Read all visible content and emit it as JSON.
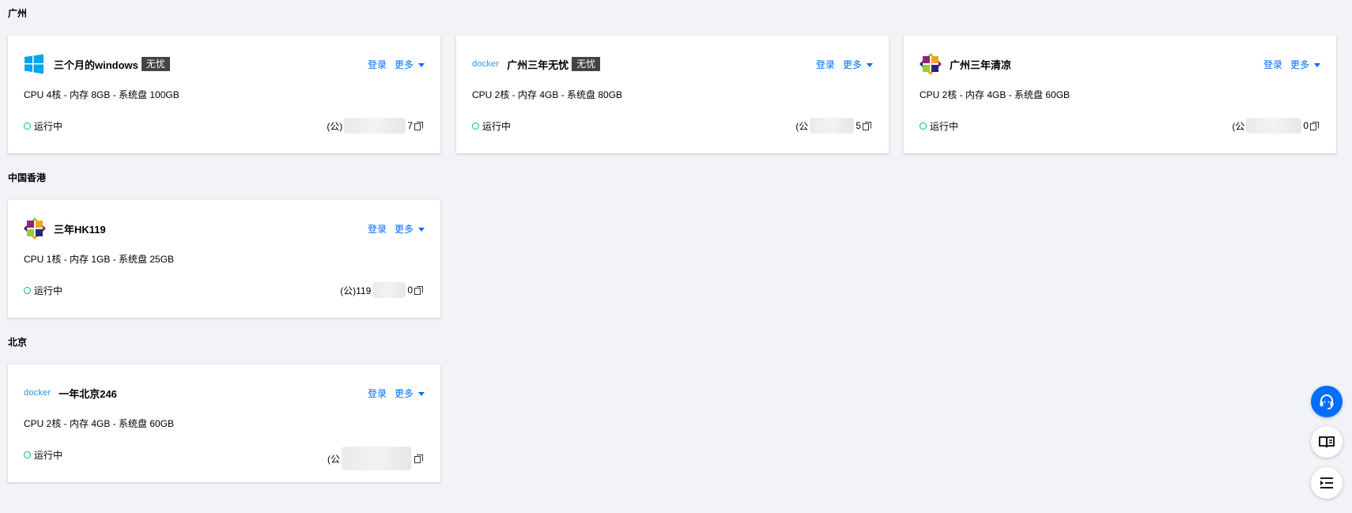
{
  "actions": {
    "login": "登录",
    "more": "更多"
  },
  "regions": [
    {
      "title": "广州",
      "instances": [
        {
          "logo": "windows-logo-icon",
          "name": "三个月的windows",
          "tag": "无忧",
          "spec": "CPU 4核 - 内存 8GB - 系统盘 100GB",
          "status": "运行中",
          "ip_prefix": "(公)",
          "ip_suffix": "7"
        },
        {
          "logo": "docker-logo",
          "logo_text": "docker",
          "name": "广州三年无忧",
          "tag": "无忧",
          "spec": "CPU 2核 - 内存 4GB - 系统盘 80GB",
          "status": "运行中",
          "ip_prefix": "(公",
          "ip_suffix": "5"
        },
        {
          "logo": "centos-logo-icon",
          "name": "广州三年清凉",
          "spec": "CPU 2核 - 内存 4GB - 系统盘 60GB",
          "status": "运行中",
          "ip_prefix": "(公",
          "ip_suffix": "0"
        }
      ]
    },
    {
      "title": "中国香港",
      "instances": [
        {
          "logo": "centos-logo-icon",
          "name": "三年HK119",
          "spec": "CPU 1核 - 内存 1GB - 系统盘 25GB",
          "status": "运行中",
          "ip_prefix": "(公)119",
          "ip_suffix": "0"
        }
      ]
    },
    {
      "title": "北京",
      "instances": [
        {
          "logo": "docker-logo",
          "logo_text": "docker",
          "name": "一年北京246",
          "spec": "CPU 2核 - 内存 4GB - 系统盘 60GB",
          "status": "运行中",
          "ip_prefix": "(公",
          "ip_suffix": ""
        }
      ]
    }
  ],
  "colors": {
    "accent": "#006eff",
    "running": "#0abf5b",
    "tag_bg": "#444444",
    "page_bg": "#f2f3f7"
  },
  "floating_tools": [
    "headset-icon",
    "book-icon",
    "list-indent-icon"
  ]
}
